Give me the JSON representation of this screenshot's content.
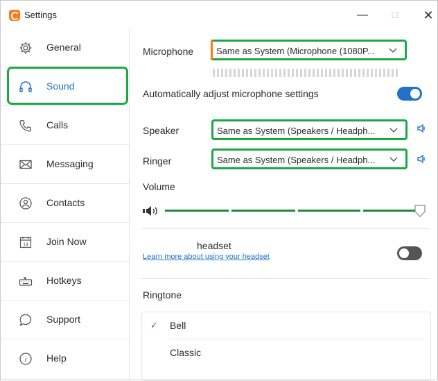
{
  "window": {
    "title": "Settings",
    "controls": {
      "minimize": "—",
      "maximize": "☐",
      "close": "✕"
    }
  },
  "sidebar": {
    "items": [
      {
        "label": "General",
        "icon": "gear-icon"
      },
      {
        "label": "Sound",
        "icon": "headphones-icon",
        "active": true
      },
      {
        "label": "Calls",
        "icon": "phone-icon"
      },
      {
        "label": "Messaging",
        "icon": "envelope-icon"
      },
      {
        "label": "Contacts",
        "icon": "contacts-icon"
      },
      {
        "label": "Join Now",
        "icon": "calendar-icon"
      },
      {
        "label": "Hotkeys",
        "icon": "keyboard-icon"
      },
      {
        "label": "Support",
        "icon": "chat-bubble-icon"
      },
      {
        "label": "Help",
        "icon": "info-icon"
      }
    ],
    "calendar_icon_day": "14"
  },
  "sound": {
    "microphone": {
      "label": "Microphone",
      "value": "Same as System (Microphone (1080P..."
    },
    "auto_adjust": {
      "label": "Automatically adjust microphone settings",
      "enabled": true
    },
    "speaker": {
      "label": "Speaker",
      "value": "Same as System (Speakers / Headph..."
    },
    "ringer": {
      "label": "Ringer",
      "value": "Same as System (Speakers / Headph..."
    },
    "volume": {
      "label": "Volume",
      "level": 0.98
    },
    "headset": {
      "label": "headset",
      "link": "Learn more about using your headset",
      "enabled": false
    },
    "ringtone": {
      "label": "Ringtone",
      "options": [
        {
          "label": "Bell",
          "selected": true,
          "check": "✓"
        },
        {
          "label": "Classic",
          "selected": false
        }
      ]
    }
  },
  "colors": {
    "accent": "#1f72c8",
    "highlight": "#1aa845",
    "brand": "#ff7a1a"
  }
}
